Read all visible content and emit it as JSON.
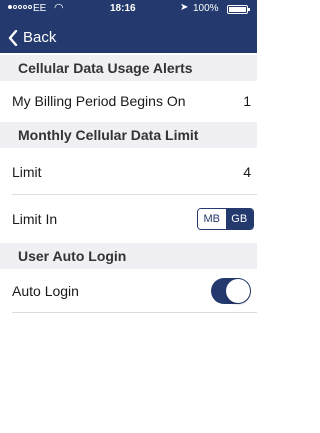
{
  "status_bar": {
    "carrier": "EE",
    "time": "18:16",
    "battery": "100%"
  },
  "nav": {
    "back_label": "Back"
  },
  "sections": {
    "usage_alerts": {
      "title": "Cellular Data Usage Alerts",
      "billing_label": "My Billing Period Begins On",
      "billing_value": "1"
    },
    "monthly_limit": {
      "title": "Monthly Cellular Data Limit",
      "limit_label": "Limit",
      "limit_value": "4",
      "unit_label": "Limit In",
      "unit_options": [
        "MB",
        "GB"
      ],
      "unit_selected": "GB"
    },
    "auto_login": {
      "title": "User Auto Login",
      "label": "Auto Login",
      "enabled": true
    }
  },
  "colors": {
    "accent": "#243a6e",
    "section_bg": "#efeff4"
  }
}
